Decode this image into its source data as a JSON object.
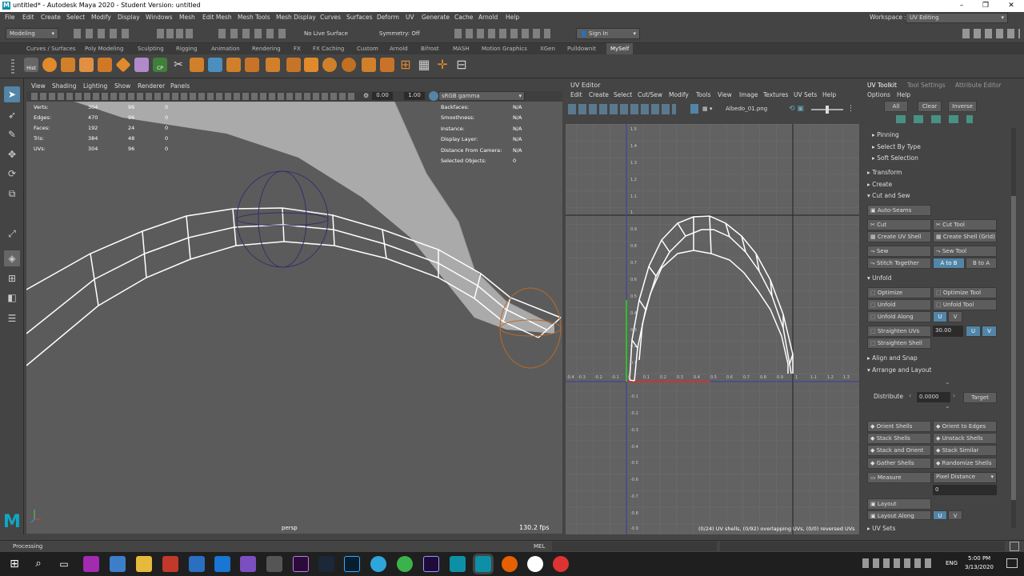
{
  "window": {
    "title": "untitled* - Autodesk Maya 2020 - Student Version: untitled",
    "logo": "M",
    "min": "–",
    "max": "❐",
    "close": "✕"
  },
  "menus": [
    "File",
    "Edit",
    "Create",
    "Select",
    "Modify",
    "Display",
    "Windows",
    "Mesh",
    "Edit Mesh",
    "Mesh Tools",
    "Mesh Display",
    "Curves",
    "Surfaces",
    "Deform",
    "UV",
    "Generate",
    "Cache",
    "Arnold",
    "Help"
  ],
  "workspace": {
    "label": "Workspace :",
    "value": "UV Editing"
  },
  "statusline": {
    "mode": "Modeling",
    "live_surface": "No Live Surface",
    "symmetry": "Symmetry: Off",
    "sign_in": "Sign In"
  },
  "shelf_tabs": [
    "Curves / Surfaces",
    "Poly Modeling",
    "Sculpting",
    "Rigging",
    "Animation",
    "Rendering",
    "FX",
    "FX Caching",
    "Custom",
    "Arnold",
    "Bifrost",
    "MASH",
    "Motion Graphics",
    "XGen",
    "Pulldownit",
    "MySelf"
  ],
  "shelf_active": "MySelf",
  "shelf_labels": {
    "hist": "Hist",
    "cp": "CP"
  },
  "viewport": {
    "menus": [
      "View",
      "Shading",
      "Lighting",
      "Show",
      "Renderer",
      "Panels"
    ],
    "val1": "0.00",
    "val2": "1.00",
    "colorspace": "sRGB gamma",
    "hud_left": [
      [
        "Verts:",
        "304",
        "96",
        "0"
      ],
      [
        "Edges:",
        "470",
        "96",
        "0"
      ],
      [
        "Faces:",
        "192",
        "24",
        "0"
      ],
      [
        "Tris:",
        "384",
        "48",
        "0"
      ],
      [
        "UVs:",
        "304",
        "96",
        "0"
      ]
    ],
    "hud_right": [
      [
        "Backfaces:",
        "N/A"
      ],
      [
        "Smoothness:",
        "N/A"
      ],
      [
        "Instance:",
        "N/A"
      ],
      [
        "Display Layer:",
        "N/A"
      ],
      [
        "Distance From Camera:",
        "N/A"
      ],
      [
        "Selected Objects:",
        "0"
      ]
    ],
    "camera": "persp",
    "fps": "130.2 fps"
  },
  "uv_editor": {
    "title": "UV Editor",
    "menus": [
      "Edit",
      "Create",
      "Select",
      "Cut/Sew",
      "Modify",
      "Tools",
      "View",
      "Image",
      "Textures",
      "UV Sets",
      "Help"
    ],
    "image": "Albedo_01.png",
    "status": "(0/24) UV shells, (0/92) overlapping UVs, (0/0) reversed UVs",
    "v_ticks": [
      "1.5",
      "1.4",
      "1.3",
      "1.2",
      "1.1",
      "1",
      "0.9",
      "0.8",
      "0.7",
      "0.6",
      "0.5",
      "0.4",
      "0.3",
      "0.2",
      "0.1",
      "-0.1",
      "-0.2",
      "-0.3",
      "-0.4",
      "-0.5",
      "-0.6",
      "-0.7",
      "-0.8",
      "-0.9"
    ],
    "u_ticks": [
      "-0.4",
      "-0.3",
      "-0.2",
      "-0.1",
      "0",
      "0.1",
      "0.2",
      "0.3",
      "0.4",
      "0.5",
      "0.6",
      "0.7",
      "0.8",
      "0.9",
      "1",
      "1.1",
      "1.2",
      "1.3"
    ]
  },
  "toolkit": {
    "tabs": [
      "UV Toolkit",
      "Tool Settings",
      "Attribute Editor"
    ],
    "menus": [
      "Options",
      "Help"
    ],
    "sel_buttons": [
      "All",
      "Clear",
      "Inverse"
    ],
    "sub": [
      "Pinning",
      "Select By Type",
      "Soft Selection"
    ],
    "sections": [
      "Transform",
      "Create",
      "Cut and Sew"
    ],
    "auto_seams": "Auto-Seams",
    "cut": [
      "Cut",
      "Cut Tool",
      "Create UV Shell",
      "Create Shell (Grid)",
      "Sew",
      "Sew Tool",
      "Stitch Together",
      "A to B",
      "B to A"
    ],
    "unfold_title": "Unfold",
    "unfold": [
      "Optimize",
      "Optimize Tool",
      "Unfold",
      "Unfold Tool",
      "Unfold Along",
      "U",
      "V",
      "Straighten UVs",
      "30.00",
      "U",
      "V",
      "Straighten Shell"
    ],
    "align": "Align and Snap",
    "arrange": "Arrange and Layout",
    "distribute": {
      "label": "Distribute",
      "value": "0.0000",
      "target": "Target"
    },
    "orient": [
      "Orient Shells",
      "Orient to Edges",
      "Stack Shells",
      "Unstack Shells",
      "Stack and Orient",
      "Stack Similar",
      "Gather Shells",
      "Randomize Shells"
    ],
    "measure": {
      "label": "Measure",
      "mode": "Pixel Distance",
      "value": "0"
    },
    "layout": [
      "Layout",
      "Layout Along",
      "U",
      "V"
    ],
    "uvsets": "UV Sets"
  },
  "bottom": {
    "processing": "Processing",
    "mel": "MEL"
  },
  "taskbar": {
    "lang": "ENG",
    "time": "5:00 PM",
    "date": "3/13/2020"
  }
}
